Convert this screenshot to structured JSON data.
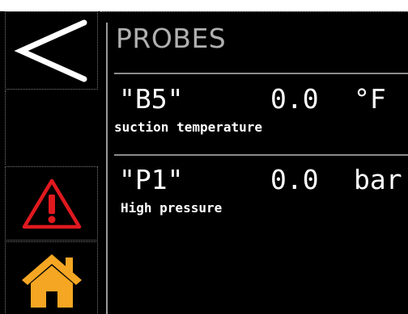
{
  "header": {
    "title": "PROBES"
  },
  "nav": {
    "back_icon": "chevron-left-icon",
    "alarm_icon": "warning-triangle-icon",
    "home_icon": "home-icon",
    "colors": {
      "back_icon": "#ffffff",
      "alarm_icon": "#e0191f",
      "home_icon": "#f5a623"
    }
  },
  "probes": [
    {
      "name": "\"B5\"",
      "value": "0.0",
      "unit": "°F",
      "description": "suction temperature"
    },
    {
      "name": "\"P1\"",
      "value": "0.0",
      "unit": "bar",
      "description": "High pressure"
    }
  ]
}
